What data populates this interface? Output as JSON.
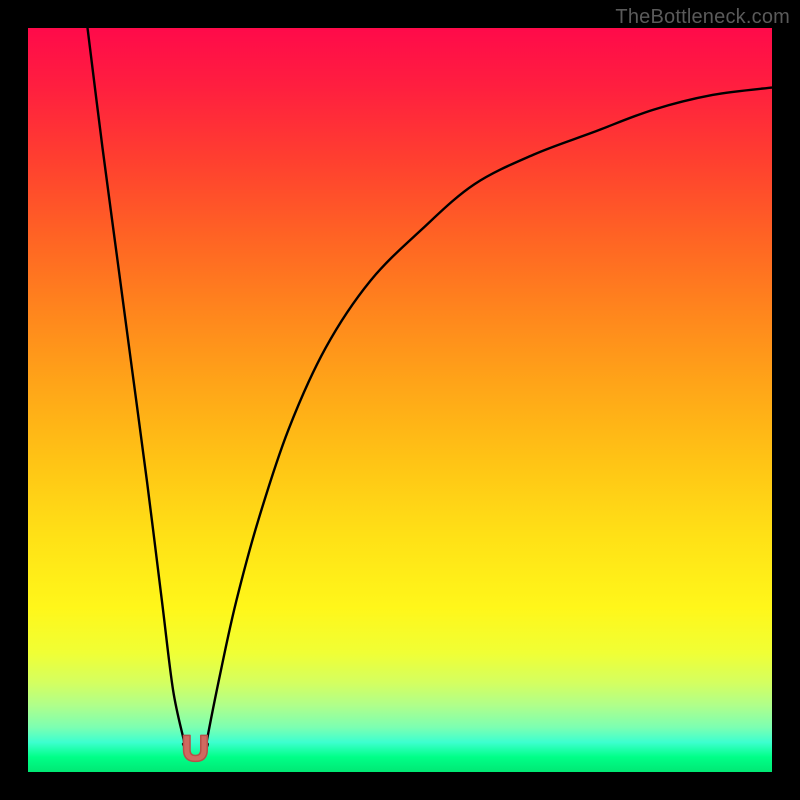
{
  "watermark": "TheBottleneck.com",
  "colors": {
    "frame": "#000000",
    "watermark": "#5a5a5a",
    "curve_stroke": "#000000",
    "marker_fill": "#cf6a60",
    "marker_stroke": "#b75049"
  },
  "chart_data": {
    "type": "line",
    "title": "",
    "xlabel": "",
    "ylabel": "",
    "xlim": [
      0,
      100
    ],
    "ylim": [
      0,
      100
    ],
    "grid": false,
    "legend": false,
    "annotations": [],
    "series": [
      {
        "name": "left-branch",
        "x": [
          8,
          10,
          12,
          14,
          16,
          18,
          19.5,
          21
        ],
        "values": [
          100,
          84,
          69,
          54,
          39,
          23,
          11,
          4
        ]
      },
      {
        "name": "right-branch",
        "x": [
          24,
          26,
          28,
          31,
          35,
          40,
          46,
          53,
          60,
          68,
          76,
          84,
          92,
          100
        ],
        "values": [
          4,
          14,
          23,
          34,
          46,
          57,
          66,
          73,
          79,
          83,
          86,
          89,
          91,
          92
        ]
      }
    ],
    "marker": {
      "x_center": 22.5,
      "y_center": 3,
      "shape": "u",
      "width": 3.2,
      "height": 3.5
    }
  }
}
